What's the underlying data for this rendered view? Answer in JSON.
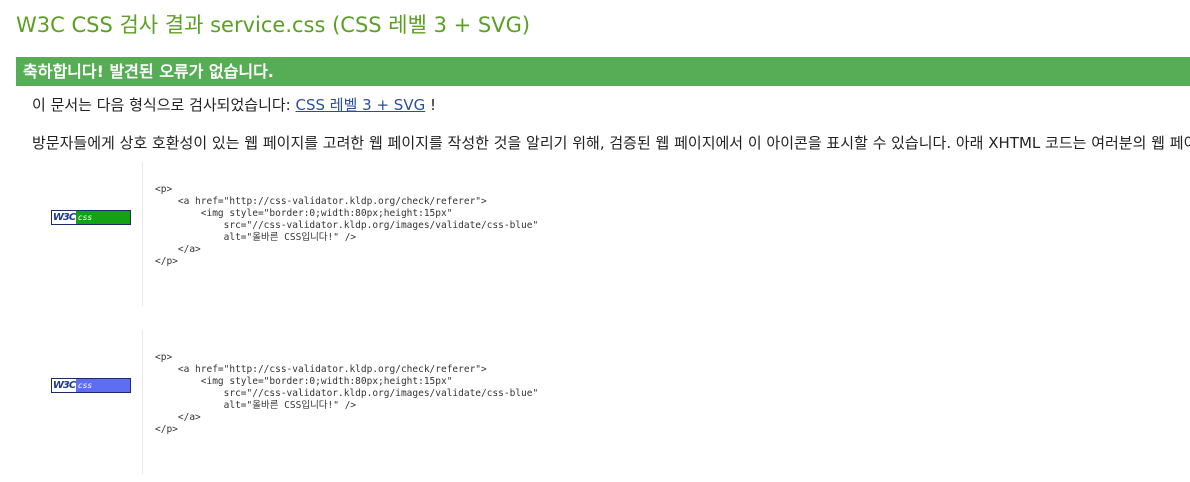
{
  "title": "W3C CSS 검사 결과 service.css (CSS 레벨 3 + SVG)",
  "banner": "축하합니다! 발견된 오류가 없습니다.",
  "info": {
    "prefix": "이 문서는 다음 형식으로 검사되었습니다: ",
    "link": "CSS 레벨 3 + SVG",
    "suffix": " !"
  },
  "description": "방문자들에게 상호 호환성이 있는 웹 페이지를 고려한 웹 페이지를 작성한 것을 알리기 위해, 검증된 웹 페이지에서 이 아이콘을 표시할 수 있습니다. 아래 XHTML 코드는 여러분의 웹 페이지에 이 아이콘을 추가하기 위해 쓸 수 있습니다.",
  "icons": [
    {
      "badge_w3c": "W3C",
      "badge_css": "css",
      "badge_color": "#12a212",
      "code": "<p>\n    <a href=\"http://css-validator.kldp.org/check/referer\">\n        <img style=\"border:0;width:80px;height:15px\"\n            src=\"//css-validator.kldp.org/images/validate/css-blue\"\n            alt=\"올바른 CSS입니다!\" />\n    </a>\n</p>"
    },
    {
      "badge_w3c": "W3C",
      "badge_css": "css",
      "badge_color": "#5f6df0",
      "code": "<p>\n    <a href=\"http://css-validator.kldp.org/check/referer\">\n        <img style=\"border:0;width:80px;height:15px\"\n            src=\"//css-validator.kldp.org/images/validate/css-blue\"\n            alt=\"올바른 CSS입니다!\" />\n    </a>\n</p>"
    }
  ]
}
